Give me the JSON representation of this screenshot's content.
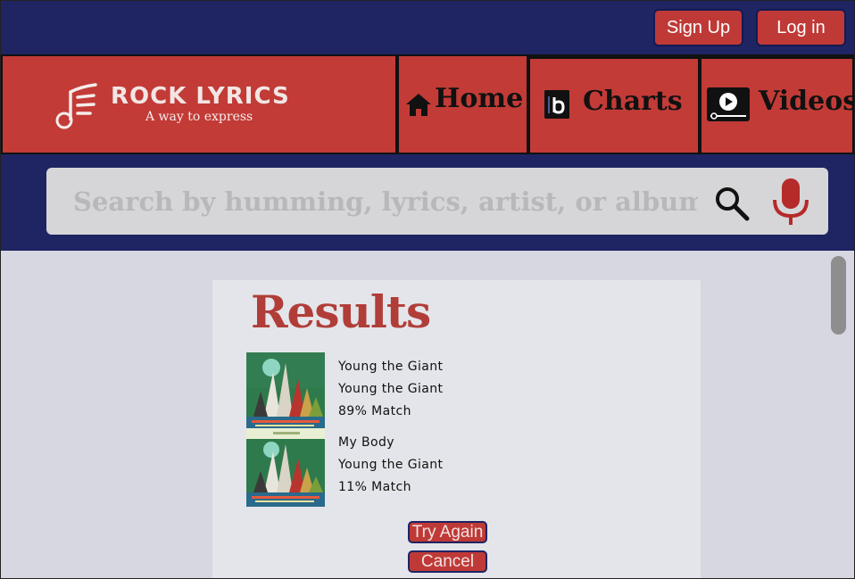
{
  "auth": {
    "signup_label": "Sign Up",
    "login_label": "Log in"
  },
  "brand": {
    "name": "ROCK LYRICS",
    "tagline": "A way to express",
    "icon": "music-note-lines-icon"
  },
  "nav": {
    "items": [
      {
        "label": "Home",
        "icon": "home-icon"
      },
      {
        "label": "Charts",
        "icon": "billboard-icon"
      },
      {
        "label": "Videos",
        "icon": "video-play-icon"
      }
    ]
  },
  "search": {
    "placeholder": "Search by humming, lyrics, artist, or album",
    "search_icon": "search-icon",
    "mic_icon": "microphone-icon"
  },
  "results": {
    "title": "Results",
    "items": [
      {
        "song": "Young the Giant",
        "artist": "Young the Giant",
        "match": "89% Match"
      },
      {
        "song": "My Body",
        "artist": "Young the Giant",
        "match": "11% Match"
      }
    ],
    "try_again_label": "Try Again",
    "cancel_label": "Cancel"
  },
  "colors": {
    "navy": "#1f2463",
    "red": "#c23b37",
    "results_title": "#b13d38",
    "content_bg": "#d6d7e1",
    "panel_bg": "#e4e5ea"
  }
}
